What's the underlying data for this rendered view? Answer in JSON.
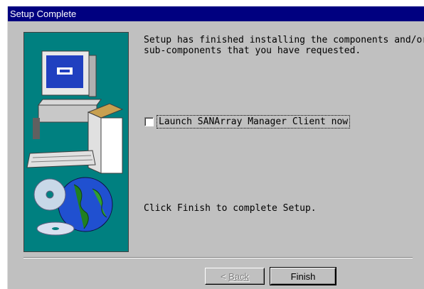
{
  "window": {
    "title": "Setup Complete"
  },
  "content": {
    "message_top": "Setup has finished installing the components and/or\nsub-components that you have requested.",
    "checkbox_label": "Launch SANArray Manager Client now",
    "checkbox_checked": false,
    "message_bottom": "Click Finish to complete Setup."
  },
  "buttons": {
    "back_arrow": "<",
    "back_label": "Back",
    "back_enabled": false,
    "finish_label": "Finish"
  },
  "colors": {
    "titlebar": "#000080",
    "dialog_face": "#c0c0c0",
    "art_background": "#008080"
  },
  "icons": {
    "art": "computer-box-cd-globe-illustration"
  }
}
